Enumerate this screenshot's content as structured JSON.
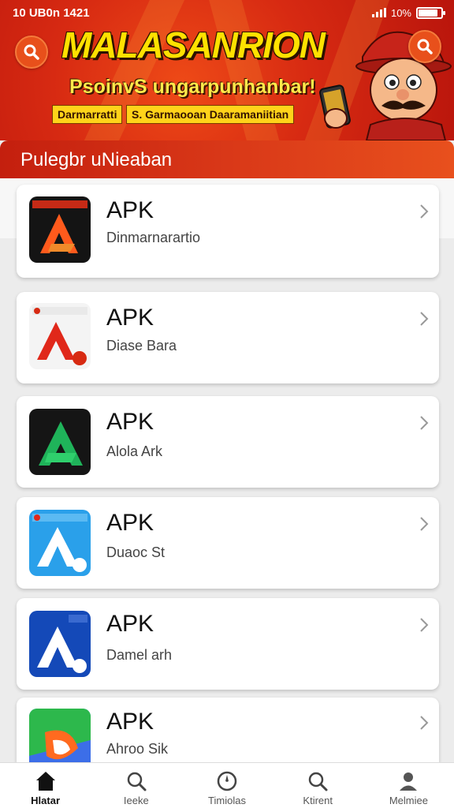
{
  "status_bar": {
    "time": "10 UB0n 1421",
    "battery_text": "10%"
  },
  "banner": {
    "title": "MALASANRION",
    "subtitle": "PsoinvS ungarpunhanbar!",
    "tag_left": "Darmarratti",
    "tag_right": "S. Garmaooan Daaramaniitian"
  },
  "section": {
    "title": "Pulegbr uNieaban"
  },
  "apps": [
    {
      "title": "APK",
      "subtitle": "Dinmarnarartio",
      "icon": "apk-logo-orange-on-black"
    },
    {
      "title": "APK",
      "subtitle": "Diase Bara",
      "icon": "apk-logo-red-on-white"
    },
    {
      "title": "APK",
      "subtitle": "Alola Ark",
      "icon": "apk-logo-green-on-black"
    },
    {
      "title": "APK",
      "subtitle": "Duaoc St",
      "icon": "apk-logo-white-on-lightblue"
    },
    {
      "title": "APK",
      "subtitle": "Damel arh",
      "icon": "apk-logo-white-on-darkblue"
    },
    {
      "title": "APK",
      "subtitle": "Ahroo Sik",
      "icon": "apk-logo-multicolor"
    }
  ],
  "tabs": [
    {
      "label": "Hlatar",
      "icon": "home-icon",
      "active": true
    },
    {
      "label": "Ieeke",
      "icon": "search-icon"
    },
    {
      "label": "Timiolas",
      "icon": "compass-icon"
    },
    {
      "label": "Ktirent",
      "icon": "search-icon"
    },
    {
      "label": "Melmiee",
      "icon": "profile-icon"
    }
  ],
  "colors": {
    "accent": "#d72a12",
    "banner_text": "#ffe100",
    "card_bg": "#ffffff"
  }
}
